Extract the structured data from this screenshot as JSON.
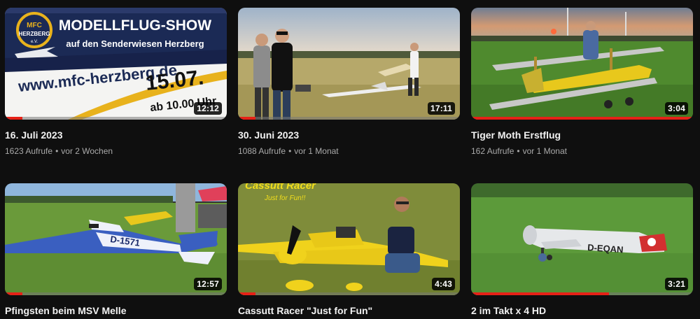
{
  "videos": [
    {
      "title": "16. Juli 2023",
      "views": "1623 Aufrufe",
      "age": "vor 2 Wochen",
      "duration": "12:12",
      "watched_fraction": 0.08,
      "thumbnail": {
        "banner_line1": "MODELLFLUG-SHOW",
        "banner_line2": "auf den Senderwiesen Herzberg",
        "logo_line1": "MFC",
        "logo_line2": "HERZBERG",
        "logo_line3": "e.V.",
        "url_text": "www.mfc-herzberg.de",
        "date_text": "15.07.",
        "time_text": "ab 10.00 Uhr"
      }
    },
    {
      "title": "30. Juni 2023",
      "views": "1088 Aufrufe",
      "age": "vor 1 Monat",
      "duration": "17:11",
      "watched_fraction": 0.08,
      "thumbnail": {}
    },
    {
      "title": "Tiger Moth Erstflug",
      "views": "162 Aufrufe",
      "age": "vor 1 Monat",
      "duration": "3:04",
      "watched_fraction": 1.0,
      "thumbnail": {}
    },
    {
      "title": "Pfingsten beim MSV Melle",
      "views": "",
      "age": "",
      "duration": "12:57",
      "watched_fraction": 0.08,
      "thumbnail": {
        "registration": "D-1571"
      }
    },
    {
      "title": "Cassutt Racer \"Just for Fun\"",
      "views": "",
      "age": "",
      "duration": "4:43",
      "watched_fraction": 0.08,
      "thumbnail": {
        "overlay_title": "Cassutt Racer",
        "overlay_sub": "Just for Fun!!"
      }
    },
    {
      "title": "2 im Takt x 4 HD",
      "views": "",
      "age": "",
      "duration": "3:21",
      "watched_fraction": 0.62,
      "thumbnail": {
        "registration": "D-EQAN"
      }
    }
  ],
  "meta_separator": "•",
  "colors": {
    "background": "#0f0f0f",
    "title": "#f1f1f1",
    "meta": "#aaaaaa",
    "progress": "#e62117"
  }
}
